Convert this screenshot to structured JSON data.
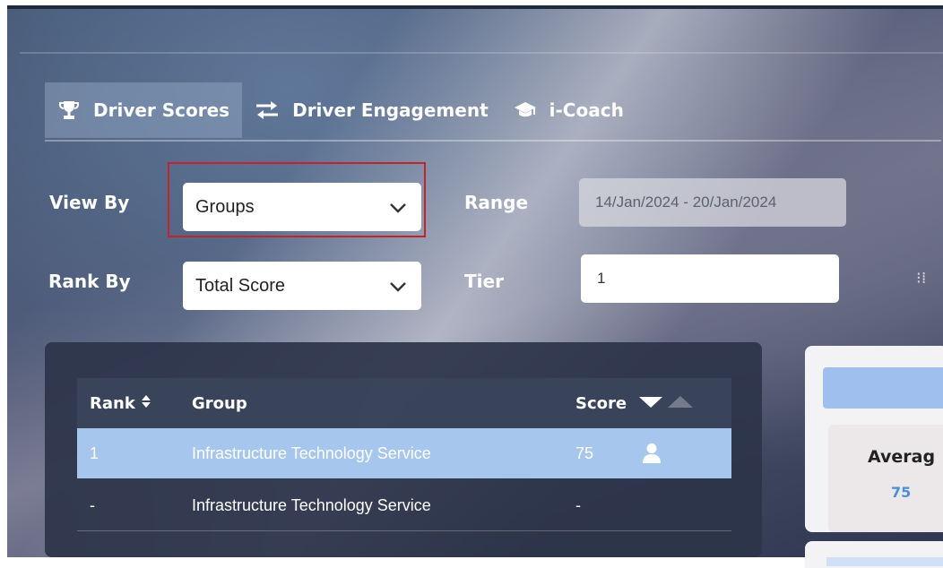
{
  "tabs": [
    {
      "label": "Driver Scores",
      "icon": "trophy-icon",
      "active": true
    },
    {
      "label": "Driver Engagement",
      "icon": "exchange-arrows-icon",
      "active": false
    },
    {
      "label": "i-Coach",
      "icon": "graduation-cap-icon",
      "active": false
    }
  ],
  "filters": {
    "view_by_label": "View By",
    "view_by_value": "Groups",
    "rank_by_label": "Rank By",
    "rank_by_value": "Total Score",
    "range_label": "Range",
    "range_value": "14/Jan/2024 - 20/Jan/2024",
    "tier_label": "Tier",
    "tier_value": "1"
  },
  "table": {
    "headers": {
      "rank": "Rank",
      "group": "Group",
      "score": "Score"
    },
    "rows": [
      {
        "rank": "1",
        "group": "Infrastructure Technology Service",
        "score": "75",
        "selected": true
      },
      {
        "rank": "-",
        "group": "Infrastructure Technology Service",
        "score": "-",
        "selected": false
      }
    ]
  },
  "summary": {
    "average_label": "Averag",
    "average_value": "75"
  },
  "colors": {
    "selected_row": "#a7c6ee",
    "highlight_border": "#c0242c",
    "accent_blue": "#4a8fd9"
  }
}
